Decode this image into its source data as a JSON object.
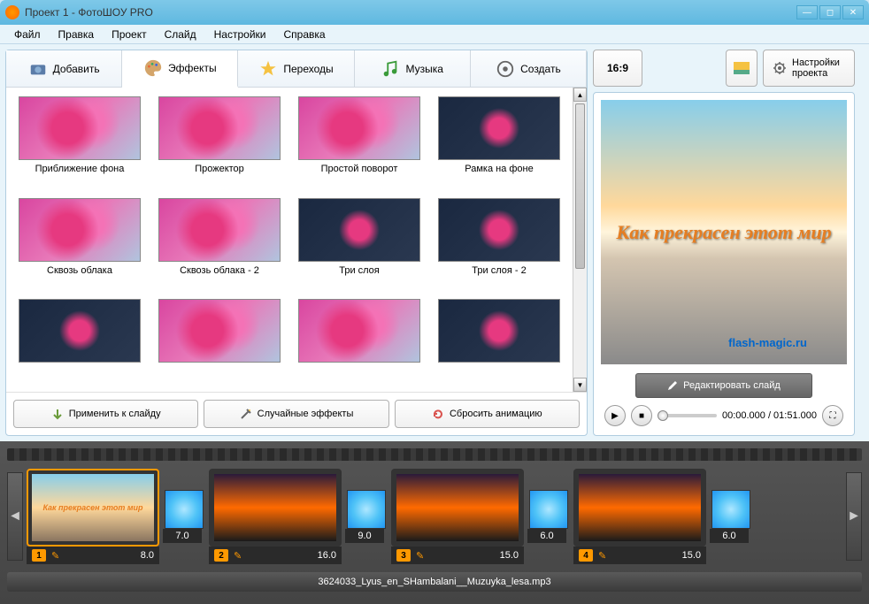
{
  "window": {
    "title": "Проект 1 - ФотоШОУ PRO"
  },
  "menu": {
    "file": "Файл",
    "edit": "Правка",
    "project": "Проект",
    "slide": "Слайд",
    "settings": "Настройки",
    "help": "Справка"
  },
  "tabs": {
    "add": "Добавить",
    "effects": "Эффекты",
    "transitions": "Переходы",
    "music": "Музыка",
    "create": "Создать"
  },
  "effects": [
    {
      "label": "Приближение фона"
    },
    {
      "label": "Прожектор"
    },
    {
      "label": "Простой поворот"
    },
    {
      "label": "Рамка на фоне"
    },
    {
      "label": "Сквозь облака"
    },
    {
      "label": "Сквозь облака - 2"
    },
    {
      "label": "Три слоя"
    },
    {
      "label": "Три слоя - 2"
    },
    {
      "label": ""
    },
    {
      "label": ""
    },
    {
      "label": ""
    },
    {
      "label": ""
    }
  ],
  "effect_actions": {
    "apply": "Применить к слайду",
    "random": "Случайные эффекты",
    "reset": "Сбросить анимацию"
  },
  "watermark": "flash-magic.ru",
  "right": {
    "aspect": "16:9",
    "project_settings": "Настройки проекта",
    "preview_text": "Как  прекрасен этот мир",
    "edit_slide": "Редактировать слайд",
    "time": "00:00.000 / 01:51.000"
  },
  "timeline": {
    "slides": [
      {
        "num": "1",
        "dur": "8.0",
        "trans_dur": "7.0",
        "preview": true
      },
      {
        "num": "2",
        "dur": "16.0",
        "trans_dur": "9.0"
      },
      {
        "num": "3",
        "dur": "15.0",
        "trans_dur": "6.0"
      },
      {
        "num": "4",
        "dur": "15.0",
        "trans_dur": "6.0"
      }
    ],
    "audio": "3624033_Lyus_en_SHambalani__Muzuyka_lesa.mp3"
  }
}
